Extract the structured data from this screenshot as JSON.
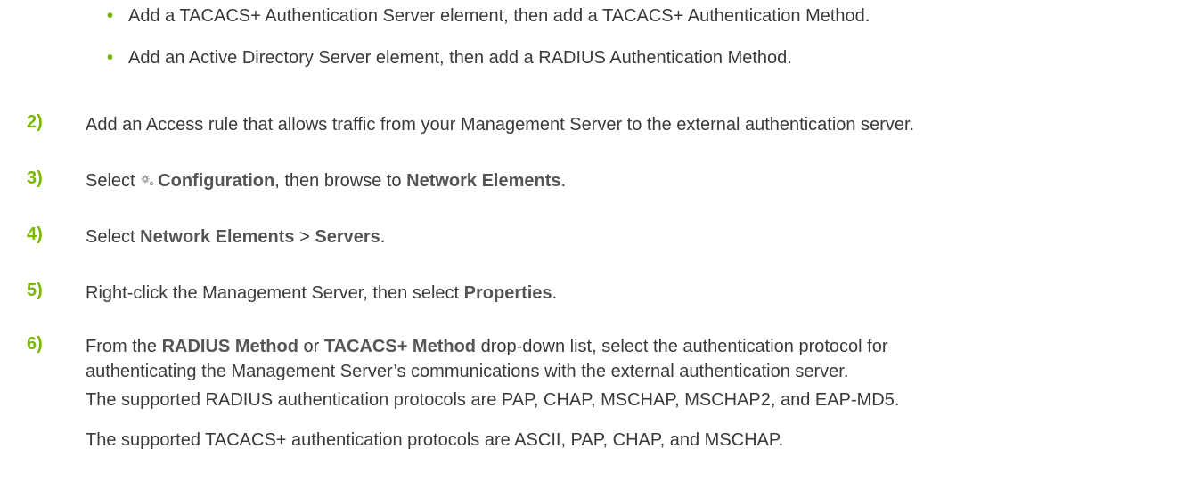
{
  "bullets": [
    "Add a TACACS+ Authentication Server element, then add a TACACS+ Authentication Method.",
    "Add an Active Directory Server element, then add a RADIUS Authentication Method."
  ],
  "bullet_symbol": "•",
  "accent_color": "#7ab800",
  "steps": {
    "s2": {
      "num": "2)",
      "text": "Add an Access rule that allows traffic from your Management Server to the external authentication server."
    },
    "s3": {
      "num": "3)",
      "pre": "Select",
      "icon": "gear-icon",
      "ui1": "Configuration",
      "mid": ", then browse to",
      "ui2": "Network Elements",
      "post": "."
    },
    "s4": {
      "num": "4)",
      "pre": "Select",
      "ui1": "Network Elements",
      "sep": ">",
      "ui2": "Servers",
      "post": "."
    },
    "s5": {
      "num": "5)",
      "pre": "Right-click the Management Server, then select",
      "ui1": "Properties",
      "post": "."
    },
    "s6": {
      "num": "6)",
      "pre": "From the",
      "ui1": "RADIUS Method",
      "mid": "or",
      "ui2": "TACACS+ Method",
      "post": "drop-down list, select the authentication protocol for",
      "line2": "authenticating the Management Server’s communications with the external authentication server.",
      "note1": "The supported RADIUS authentication protocols are PAP, CHAP, MSCHAP, MSCHAP2, and EAP-MD5.",
      "note2": "The supported TACACS+ authentication protocols are ASCII, PAP, CHAP, and MSCHAP."
    }
  }
}
